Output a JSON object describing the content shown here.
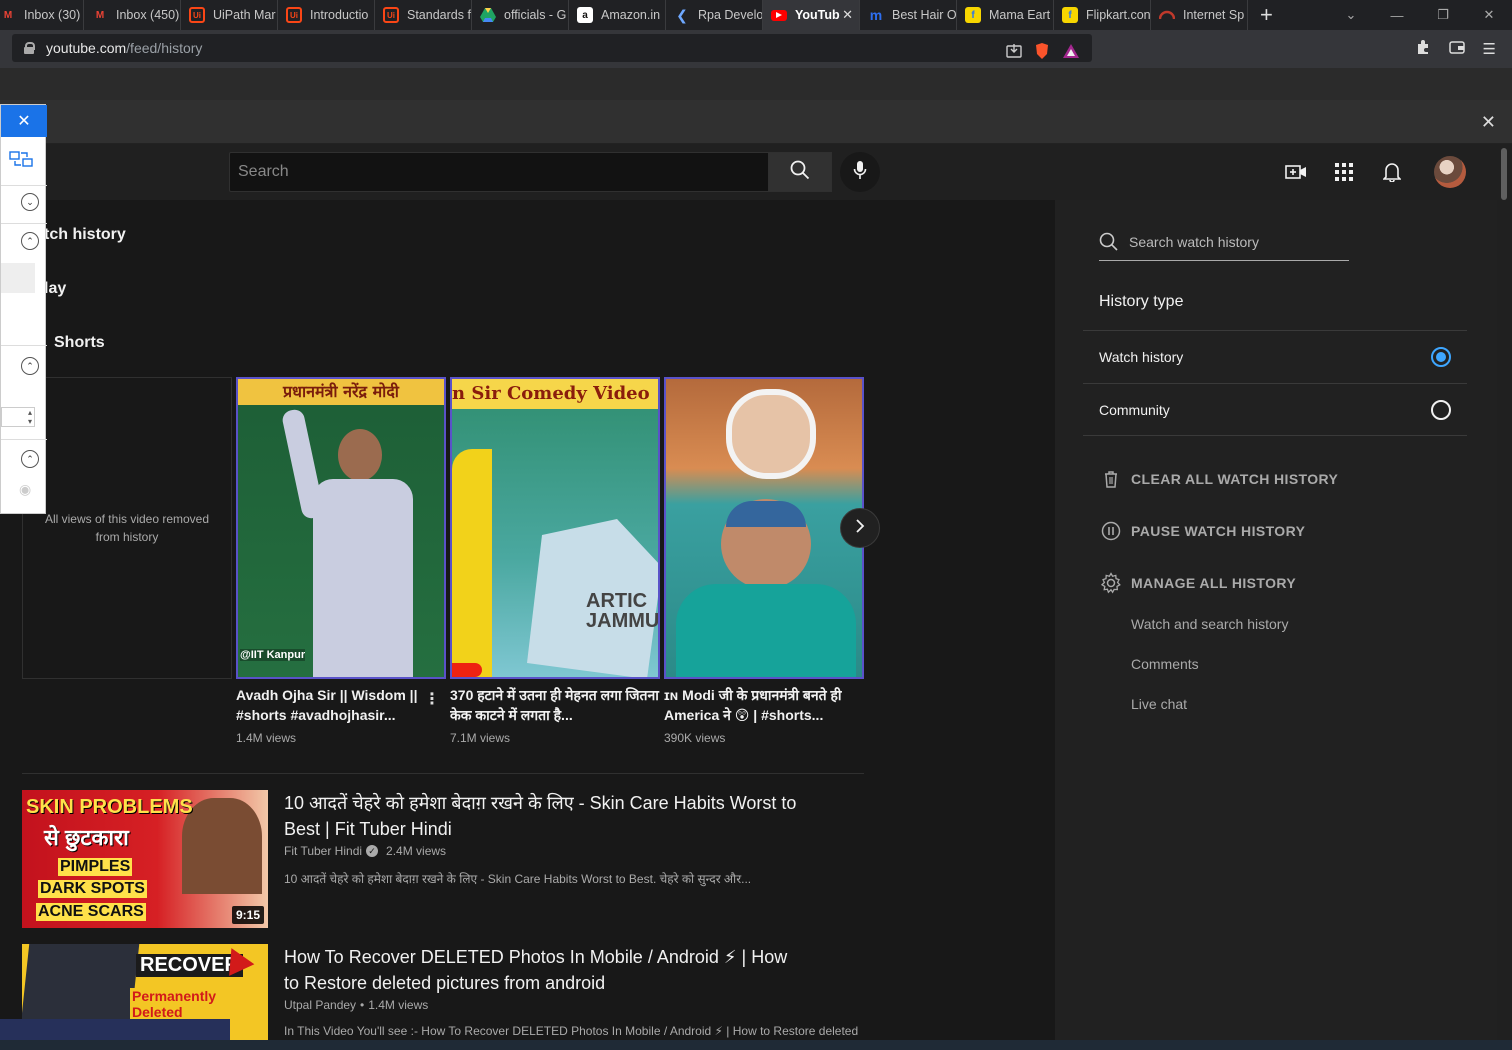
{
  "browser": {
    "tabs": [
      {
        "label": "Inbox (30)",
        "icon": "gmail-icon",
        "color": "#1a1a1a"
      },
      {
        "label": "Inbox (450)",
        "icon": "gmail-icon",
        "color": "#c5221f"
      },
      {
        "label": "UiPath Mar",
        "icon": "uipath-icon",
        "color": "#fa4616"
      },
      {
        "label": "Introductio",
        "icon": "uipath-icon",
        "color": "#fa4616"
      },
      {
        "label": "Standards f",
        "icon": "uipath-icon",
        "color": "#fa4616"
      },
      {
        "label": "officials - G",
        "icon": "drive-icon",
        "color": "#1fa463"
      },
      {
        "label": "Amazon.in",
        "icon": "amazon-icon",
        "color": "#ffffff"
      },
      {
        "label": "Rpa Develo",
        "icon": "kodekloud-icon",
        "color": "#4a6cf7"
      },
      {
        "label": "YouTub",
        "icon": "youtube-icon",
        "color": "#ff0000"
      },
      {
        "label": "Best Hair O",
        "icon": "myntra-icon",
        "color": "#2d6ef0"
      },
      {
        "label": "Mama Eart",
        "icon": "flipkart-icon",
        "color": "#f7d600"
      },
      {
        "label": "Flipkart.con",
        "icon": "flipkart-icon",
        "color": "#f7d600"
      },
      {
        "label": "Internet Sp",
        "icon": "speedtest-icon",
        "color": "#c0392b"
      }
    ],
    "url_host": "youtube.com",
    "url_path": "/feed/history"
  },
  "header": {
    "search_placeholder": "Search"
  },
  "main": {
    "sections": {
      "watch_history": "tch history",
      "today": "lay",
      "shorts": "Shorts"
    },
    "removed_text": "All views of this video removed from history",
    "shorts": [
      {
        "title": "Avadh Ojha Sir || Wisdom || #shorts #avadhojhasir...",
        "views": "1.4M views",
        "overlay_top": "प्रधानमंत्री नरेंद्र मोदी",
        "overlay_bottom": "@IIT Kanpur"
      },
      {
        "title": "370 हटाने में उतना ही मेहनत लगा जितना केक काटने में लगता है...",
        "views": "7.1M views",
        "overlay_top": "n Sir Comedy Video",
        "overlay_bottom": "ARTIC JAMMU"
      },
      {
        "title": "ɪɴ Modi जी के प्रधानमंत्री बनते ही America ने 😲 | #shorts...",
        "views": "390K views"
      }
    ],
    "videos": [
      {
        "title": "10 आदतें चेहरे को हमेशा बेदाग़ रखने के लिए - Skin Care Habits Worst to Best | Fit Tuber Hindi",
        "channel": "Fit Tuber Hindi",
        "views": "2.4M views",
        "description": "10 आदतें चेहरे को हमेशा बेदाग़ रखने के लिए - Skin Care Habits Worst to Best. चेहरे को सुन्दर और...",
        "duration": "9:15",
        "thumb_lines": [
          "SKIN PROBLEMS",
          "से छुटकारा",
          "PIMPLES",
          "DARK SPOTS",
          "ACNE SCARS"
        ]
      },
      {
        "title": "How To Recover DELETED Photos In Mobile / Android ⚡ | How to Restore deleted pictures from android",
        "channel": "Utpal Pandey",
        "views": "1.4M views",
        "description": "In This Video You'll see :- How To Recover DELETED Photos In Mobile / Android ⚡ | How to Restore deleted",
        "thumb_lines": [
          "RECOVER",
          "Permanently Deleted"
        ]
      }
    ]
  },
  "panel": {
    "search_placeholder": "Search watch history",
    "history_type_title": "History type",
    "options": [
      {
        "label": "Watch history",
        "selected": true
      },
      {
        "label": "Community",
        "selected": false
      }
    ],
    "actions": {
      "clear": "CLEAR ALL WATCH HISTORY",
      "pause": "PAUSE WATCH HISTORY",
      "manage": "MANAGE ALL HISTORY"
    },
    "sub_links": [
      "Watch and search history",
      "Comments",
      "Live chat"
    ]
  },
  "colors": {
    "accent_blue": "#3ea6ff",
    "bg": "#181818",
    "panel_bg": "#212121"
  }
}
